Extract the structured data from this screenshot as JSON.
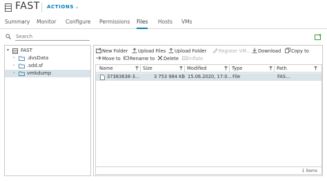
{
  "header": {
    "title": "FAST",
    "actions_label": "ACTIONS",
    "actions_caret": "⌄"
  },
  "tabs": [
    {
      "label": "Summary"
    },
    {
      "label": "Monitor"
    },
    {
      "label": "Configure"
    },
    {
      "label": "Permissions"
    },
    {
      "label": "Files"
    },
    {
      "label": "Hosts"
    },
    {
      "label": "VMs"
    }
  ],
  "active_tab": "Files",
  "search": {
    "placeholder": "Search",
    "value": ""
  },
  "tree": {
    "root": {
      "label": "FAST",
      "expanded": true
    },
    "children": [
      {
        "label": ".dvsData",
        "selected": false
      },
      {
        "label": ".sdd.sf",
        "selected": false
      },
      {
        "label": "vmkdump",
        "selected": true
      }
    ]
  },
  "toolbar": {
    "new_folder": "New Folder",
    "upload_files": "Upload Files",
    "upload_folder": "Upload Folder",
    "register_vm": "Register VM...",
    "download": "Download",
    "copy_to": "Copy to",
    "move_to": "Move to",
    "rename_to": "Rename to",
    "delete": "Delete",
    "inflate": "Inflate"
  },
  "grid": {
    "columns": [
      "Name",
      "Size",
      "Modified",
      "Type",
      "Path"
    ],
    "rows": [
      {
        "name": "37383638-3...",
        "size": "3 753 984 KB",
        "modified": "15.06.2020, 17:0...",
        "type": "File",
        "path": "FAS..."
      }
    ],
    "count_label": "1 items"
  },
  "colors": {
    "accent": "#0079b8",
    "selection": "#d9e4ea",
    "border": "#c7c7c7"
  }
}
